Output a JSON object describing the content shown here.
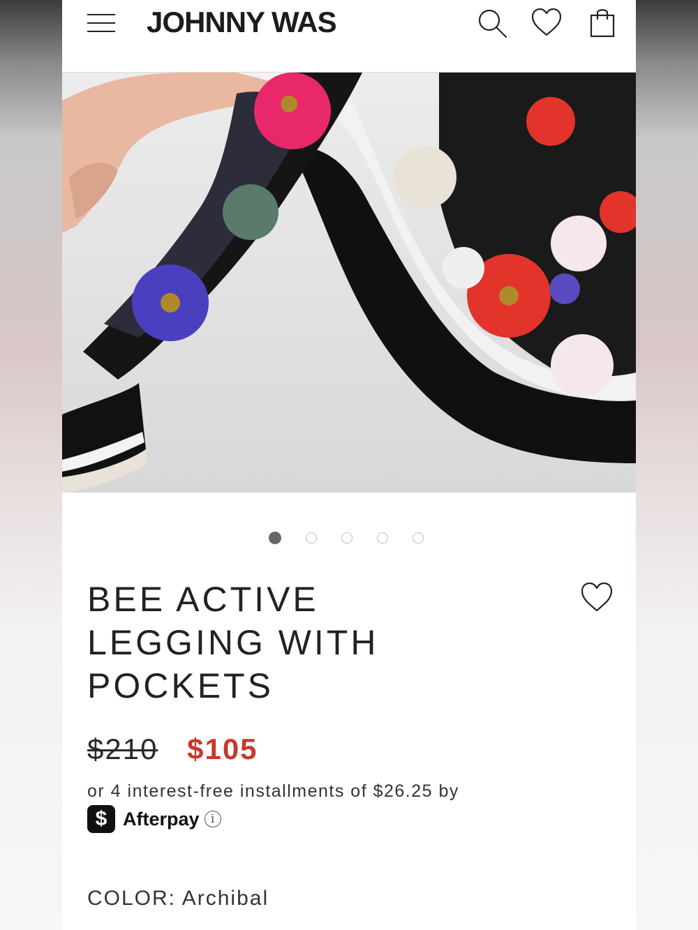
{
  "header": {
    "brand": "JOHNNY WAS",
    "icons": [
      "menu-icon",
      "search-icon",
      "heart-icon",
      "shopping-bag-icon"
    ]
  },
  "gallery": {
    "image_count": 5,
    "active_index": 0
  },
  "product": {
    "title": "BEE ACTIVE LEGGING WITH POCKETS",
    "original_price": "$210",
    "sale_price": "$105",
    "installments_text": "or 4 interest-free installments of $26.25 by",
    "afterpay_symbol": "$",
    "afterpay_label": "Afterpay",
    "afterpay_info": "i",
    "color_label": "COLOR:",
    "color_value": "Archibal"
  },
  "colors": {
    "sale_price": "#c8372d",
    "text": "#222222",
    "afterpay_badge": "#111111"
  }
}
